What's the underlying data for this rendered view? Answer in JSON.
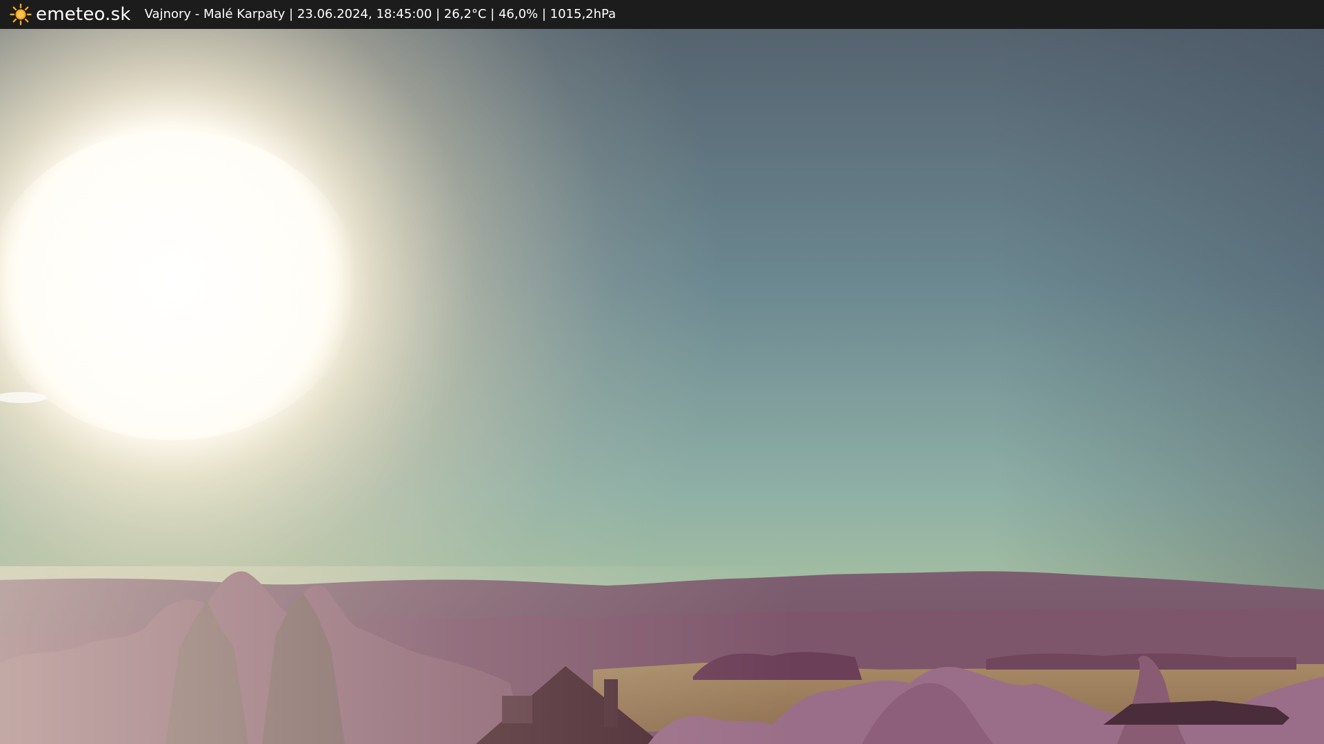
{
  "header": {
    "brand": "emeteo.sk",
    "caption": "Vajnory - Malé Karpaty | 23.06.2024, 18:45:00 | 26,2°C | 46,0% | 1015,2hPa"
  },
  "icons": {
    "logo": "sun-icon"
  },
  "colors": {
    "bar_background": "#1c1c1c",
    "bar_text": "#ffffff",
    "logo_sun": "#f5a623",
    "sky_top": "#4c5c6a",
    "sky_horizon": "#a9c4a2",
    "foliage": "#8e6278",
    "field": "#9a7f60"
  }
}
